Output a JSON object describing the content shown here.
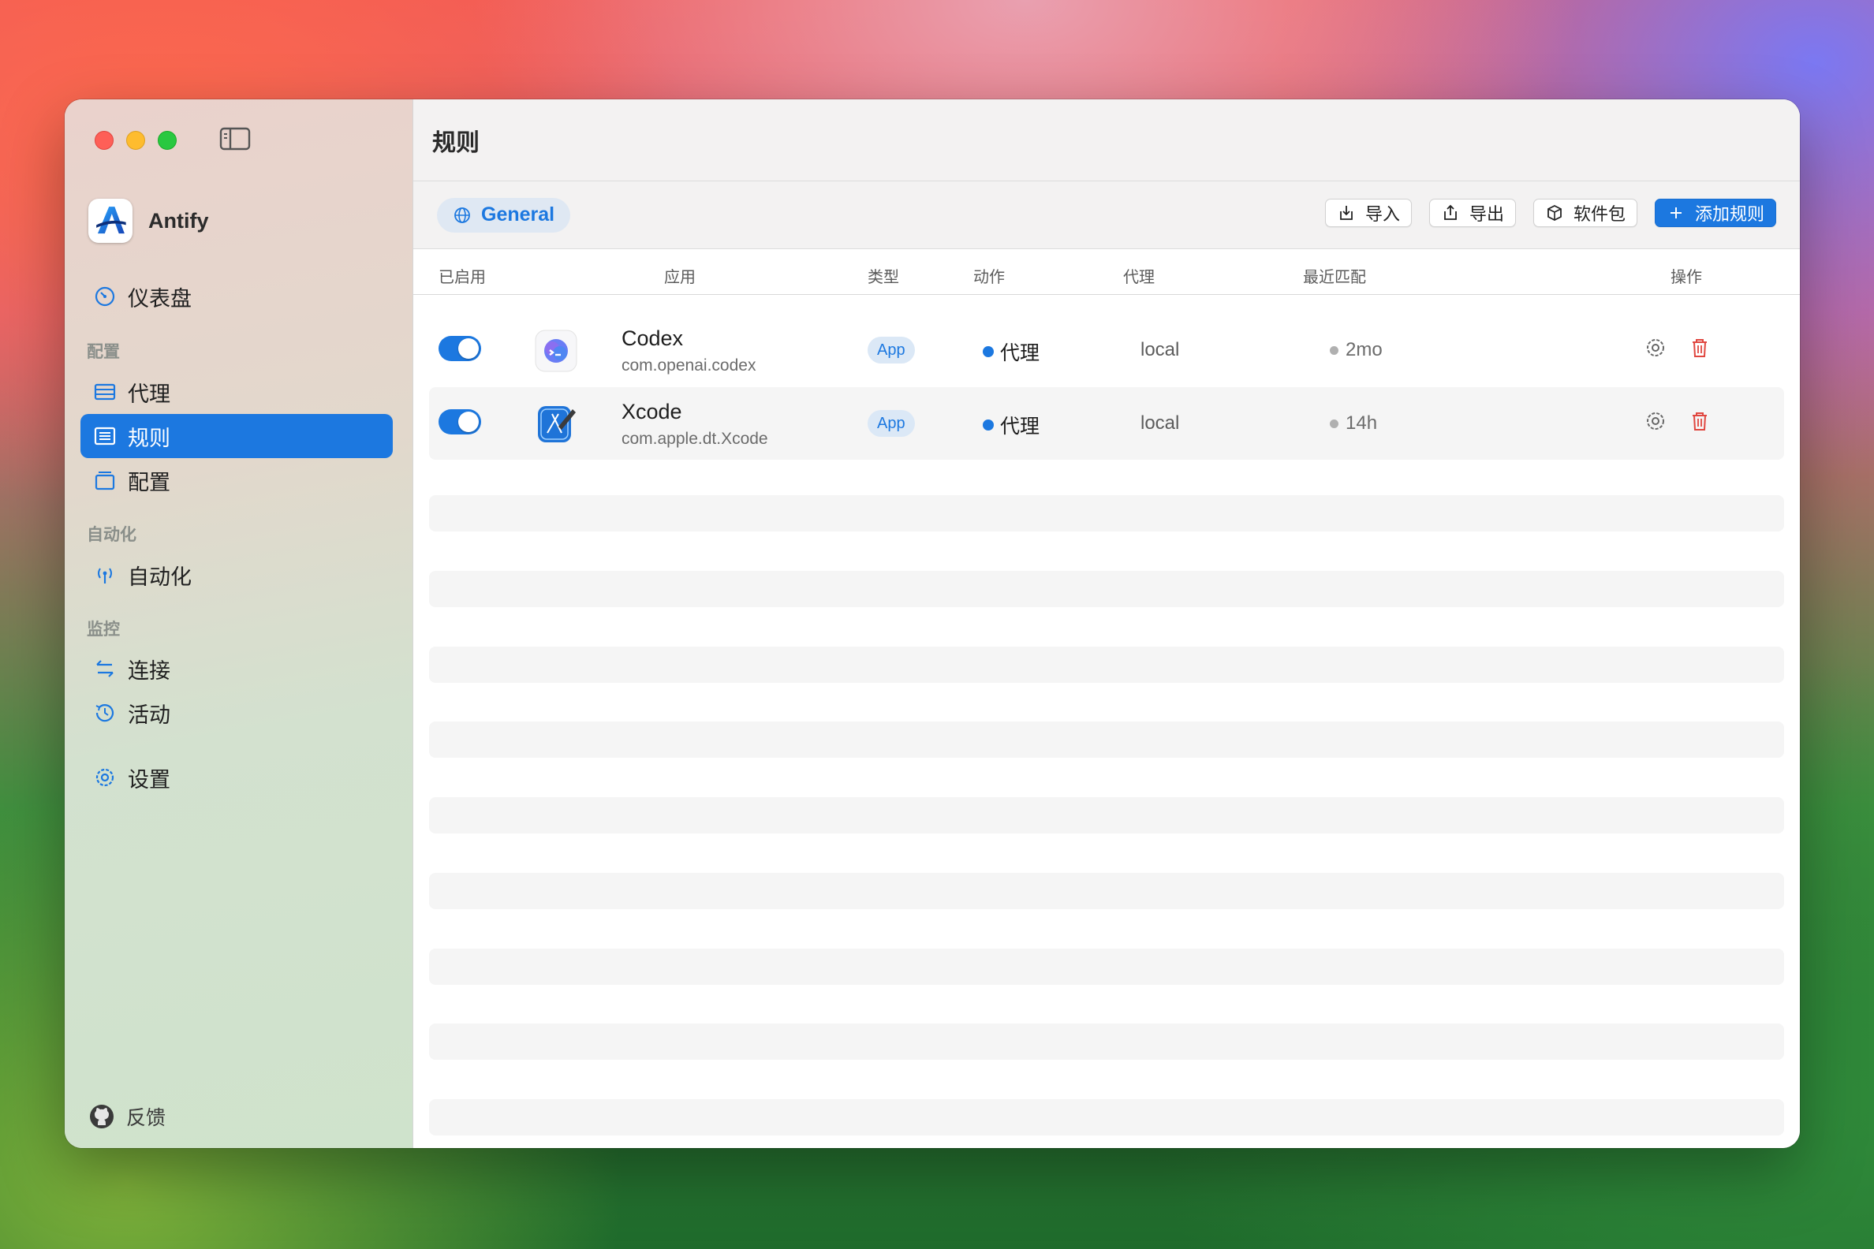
{
  "sidebar": {
    "app_name": "Antify",
    "items": [
      {
        "label": "仪表盘"
      },
      {
        "section": "配置"
      },
      {
        "label": "代理"
      },
      {
        "label": "规则"
      },
      {
        "label": "配置"
      },
      {
        "section": "自动化"
      },
      {
        "label": "自动化"
      },
      {
        "section": "监控"
      },
      {
        "label": "连接"
      },
      {
        "label": "活动"
      },
      {
        "label": "设置"
      }
    ],
    "feedback_label": "反馈"
  },
  "header": {
    "title": "规则"
  },
  "toolbar": {
    "group_chip": "General",
    "import_label": "导入",
    "export_label": "导出",
    "package_label": "软件包",
    "add_label": "添加规则"
  },
  "table": {
    "columns": [
      "已启用",
      "应用",
      "类型",
      "动作",
      "代理",
      "最近匹配",
      "操作"
    ],
    "rows": [
      {
        "enabled": true,
        "name": "Codex",
        "bundle_id": "com.openai.codex",
        "type": "App",
        "action": "代理",
        "proxy": "local",
        "last_match": "2mo"
      },
      {
        "enabled": true,
        "name": "Xcode",
        "bundle_id": "com.apple.dt.Xcode",
        "type": "App",
        "action": "代理",
        "proxy": "local",
        "last_match": "14h"
      }
    ]
  },
  "colors": {
    "accent": "#1c78e0",
    "danger": "#e0463f"
  },
  "icons": [
    "sidebar-toggle-icon",
    "gauge-icon",
    "server-icon",
    "list-icon",
    "tray-icon",
    "antenna-icon",
    "arrows-exchange-icon",
    "clock-history-icon",
    "gear-icon",
    "github-icon",
    "globe-icon",
    "import-icon",
    "export-icon",
    "package-icon",
    "plus-icon",
    "trash-icon"
  ]
}
